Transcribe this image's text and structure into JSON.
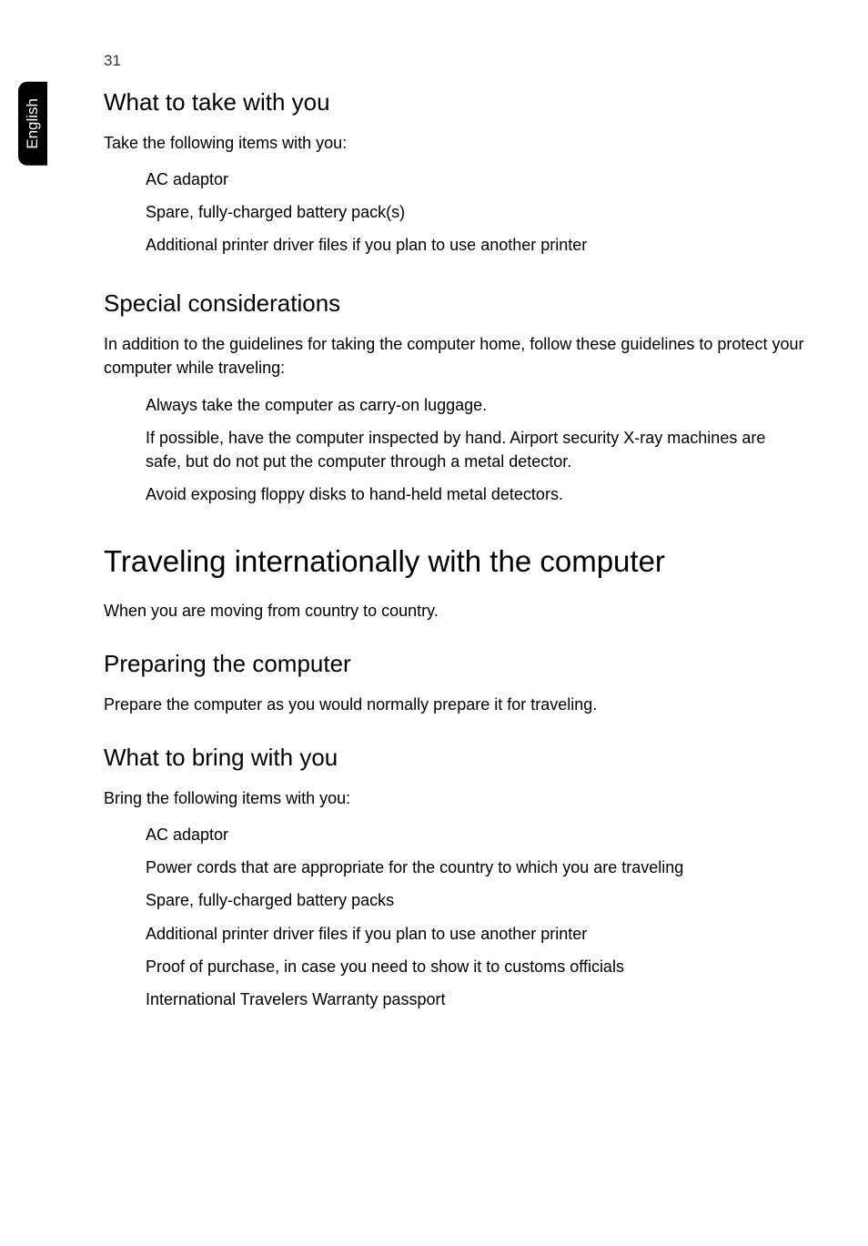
{
  "page": {
    "number": "31",
    "language_tab": "English"
  },
  "sections": {
    "what_to_take": {
      "heading": "What to take with you",
      "intro": "Take the following items with you:",
      "items": [
        "AC adaptor",
        "Spare, fully-charged battery pack(s)",
        "Additional printer driver files if you plan to use another printer"
      ]
    },
    "special_considerations": {
      "heading": "Special considerations",
      "intro": "In addition to the guidelines for taking the computer home, follow these guidelines to protect your computer while traveling:",
      "items": [
        "Always take the computer as carry-on luggage.",
        "If possible, have the computer inspected by hand. Airport security X-ray machines are safe, but do not put the computer through a metal detector.",
        "Avoid exposing floppy disks to hand-held metal detectors."
      ]
    },
    "traveling_internationally": {
      "heading": "Traveling internationally with the computer",
      "intro": "When you are moving from country to country."
    },
    "preparing_computer": {
      "heading": "Preparing the computer",
      "intro": "Prepare the computer as you would normally prepare it for traveling."
    },
    "what_to_bring": {
      "heading": "What to bring with you",
      "intro": "Bring the following items with you:",
      "items": [
        "AC adaptor",
        "Power cords that are appropriate for the country to which you are traveling",
        "Spare, fully-charged battery packs",
        "Additional printer driver files if you plan to use another printer",
        "Proof of purchase, in case you need to show it to customs officials",
        "International Travelers Warranty passport"
      ]
    }
  }
}
